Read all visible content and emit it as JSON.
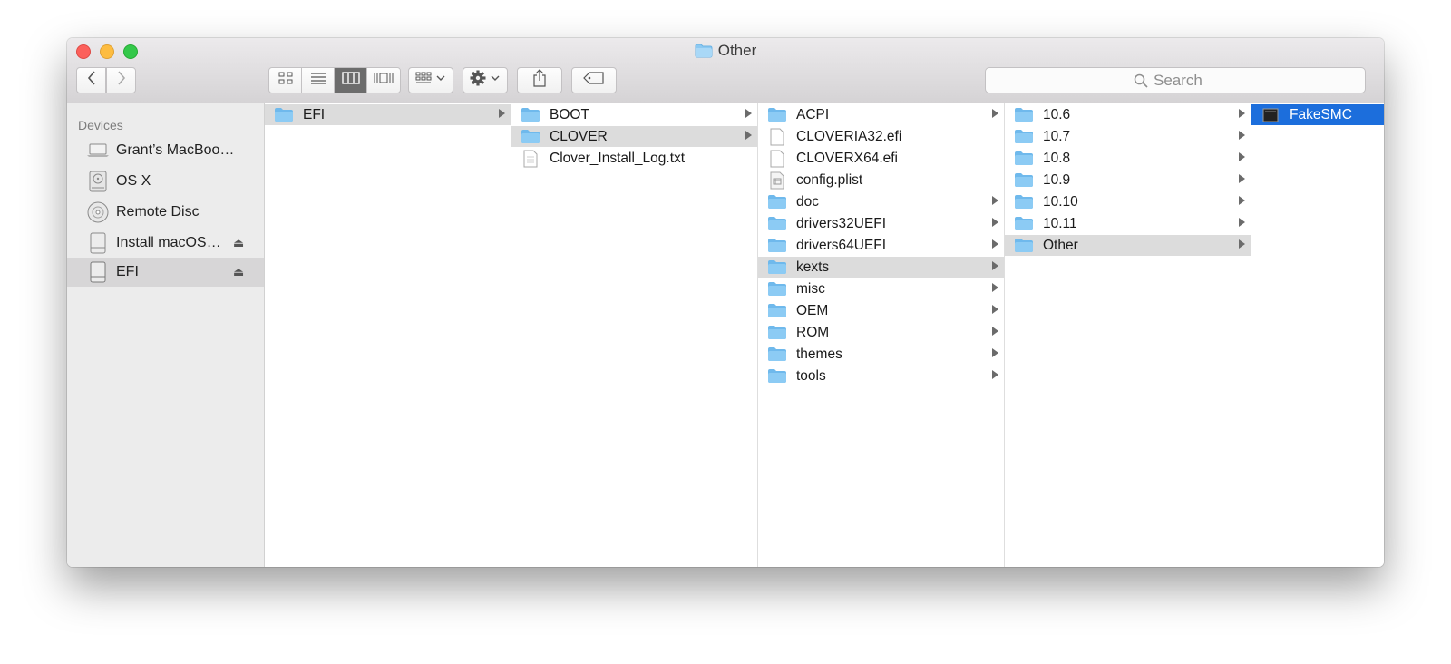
{
  "window": {
    "title": "Other"
  },
  "toolbar": {
    "back_icon": "chevron-left-icon",
    "forward_icon": "chevron-right-icon",
    "views": [
      "icon-view-icon",
      "list-view-icon",
      "column-view-icon",
      "cover-flow-icon"
    ],
    "active_view": "column-view-icon",
    "arrange_icon": "arrange-grid-icon",
    "action_icon": "gear-icon",
    "share_icon": "share-icon",
    "tag_icon": "tag-icon",
    "search_placeholder": "Search"
  },
  "sidebar": {
    "header": "Devices",
    "items": [
      {
        "label": "Grant’s MacBoo…",
        "icon": "laptop-icon",
        "eject": false
      },
      {
        "label": "OS X",
        "icon": "internal-disk-icon",
        "eject": false
      },
      {
        "label": "Remote Disc",
        "icon": "optical-disc-icon",
        "eject": false
      },
      {
        "label": "Install macOS…",
        "icon": "external-disk-icon",
        "eject": true
      },
      {
        "label": "EFI",
        "icon": "external-disk-icon",
        "eject": true,
        "selected": true
      }
    ],
    "eject_glyph": "⏏"
  },
  "columns": [
    {
      "items": [
        {
          "label": "EFI",
          "type": "folder",
          "arrow": true,
          "selected": true
        }
      ]
    },
    {
      "items": [
        {
          "label": "BOOT",
          "type": "folder",
          "arrow": true
        },
        {
          "label": "CLOVER",
          "type": "folder",
          "arrow": true,
          "selected": true
        },
        {
          "label": "Clover_Install_Log.txt",
          "type": "text-file",
          "arrow": false
        }
      ]
    },
    {
      "items": [
        {
          "label": "ACPI",
          "type": "folder",
          "arrow": true
        },
        {
          "label": "CLOVERIA32.efi",
          "type": "file",
          "arrow": false
        },
        {
          "label": "CLOVERX64.efi",
          "type": "file",
          "arrow": false
        },
        {
          "label": "config.plist",
          "type": "plist-file",
          "arrow": false
        },
        {
          "label": "doc",
          "type": "folder",
          "arrow": true
        },
        {
          "label": "drivers32UEFI",
          "type": "folder",
          "arrow": true
        },
        {
          "label": "drivers64UEFI",
          "type": "folder",
          "arrow": true
        },
        {
          "label": "kexts",
          "type": "folder",
          "arrow": true,
          "selected": true
        },
        {
          "label": "misc",
          "type": "folder",
          "arrow": true
        },
        {
          "label": "OEM",
          "type": "folder",
          "arrow": true
        },
        {
          "label": "ROM",
          "type": "folder",
          "arrow": true
        },
        {
          "label": "themes",
          "type": "folder",
          "arrow": true
        },
        {
          "label": "tools",
          "type": "folder",
          "arrow": true
        }
      ]
    },
    {
      "items": [
        {
          "label": "10.6",
          "type": "folder",
          "arrow": true
        },
        {
          "label": "10.7",
          "type": "folder",
          "arrow": true
        },
        {
          "label": "10.8",
          "type": "folder",
          "arrow": true
        },
        {
          "label": "10.9",
          "type": "folder",
          "arrow": true
        },
        {
          "label": "10.10",
          "type": "folder",
          "arrow": true
        },
        {
          "label": "10.11",
          "type": "folder",
          "arrow": true
        },
        {
          "label": "Other",
          "type": "folder",
          "arrow": true,
          "selected": true
        }
      ]
    },
    {
      "items": [
        {
          "label": "FakeSMC",
          "type": "kext-file",
          "arrow": false,
          "selected": true,
          "active": true
        }
      ]
    }
  ],
  "colors": {
    "folder": "#7cc3f0",
    "selection_active": "#1c6edc",
    "selection_inactive": "#dcdcdc"
  }
}
